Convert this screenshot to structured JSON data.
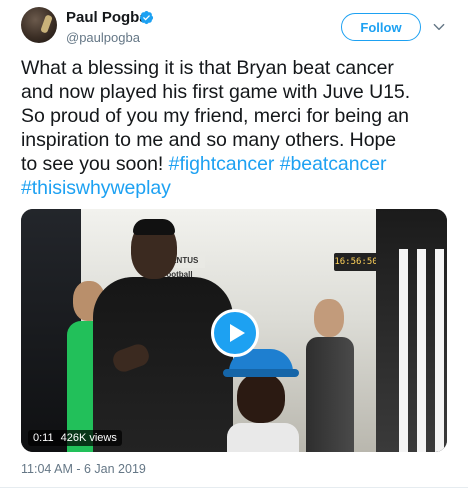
{
  "author": {
    "display_name": "Paul Pogba",
    "handle": "@paulpogba",
    "verified": true,
    "avatar_icon": "user-avatar"
  },
  "actions": {
    "follow_label": "Follow",
    "more_icon": "chevron-down-icon"
  },
  "tweet": {
    "lines": [
      [
        {
          "text": "What a blessing it is that Bryan beat cancer",
          "hashtag": false
        }
      ],
      [
        {
          "text": "and now played his first game with Juve U15.",
          "hashtag": false
        }
      ],
      [
        {
          "text": "So proud of you my friend, merci for being an",
          "hashtag": false
        }
      ],
      [
        {
          "text": "inspiration to me and so many others. Hope",
          "hashtag": false
        }
      ],
      [
        {
          "text": "to see you soon! ",
          "hashtag": false
        },
        {
          "text": "#fightcancer",
          "hashtag": true
        },
        {
          "text": " ",
          "hashtag": false
        },
        {
          "text": "#beatcancer",
          "hashtag": true
        }
      ],
      [
        {
          "text": "#thisiswhyweplay",
          "hashtag": true
        }
      ]
    ]
  },
  "media": {
    "duration": "0:11",
    "views": "426K views",
    "play_icon": "play-icon",
    "clock_text": "16:56:50",
    "wall_sign": "JUVENTUS Football"
  },
  "meta": {
    "timestamp": "11:04 AM - 6 Jan 2019"
  },
  "colors": {
    "accent": "#1da1f2",
    "text": "#14171a",
    "secondary_text": "#657786"
  }
}
